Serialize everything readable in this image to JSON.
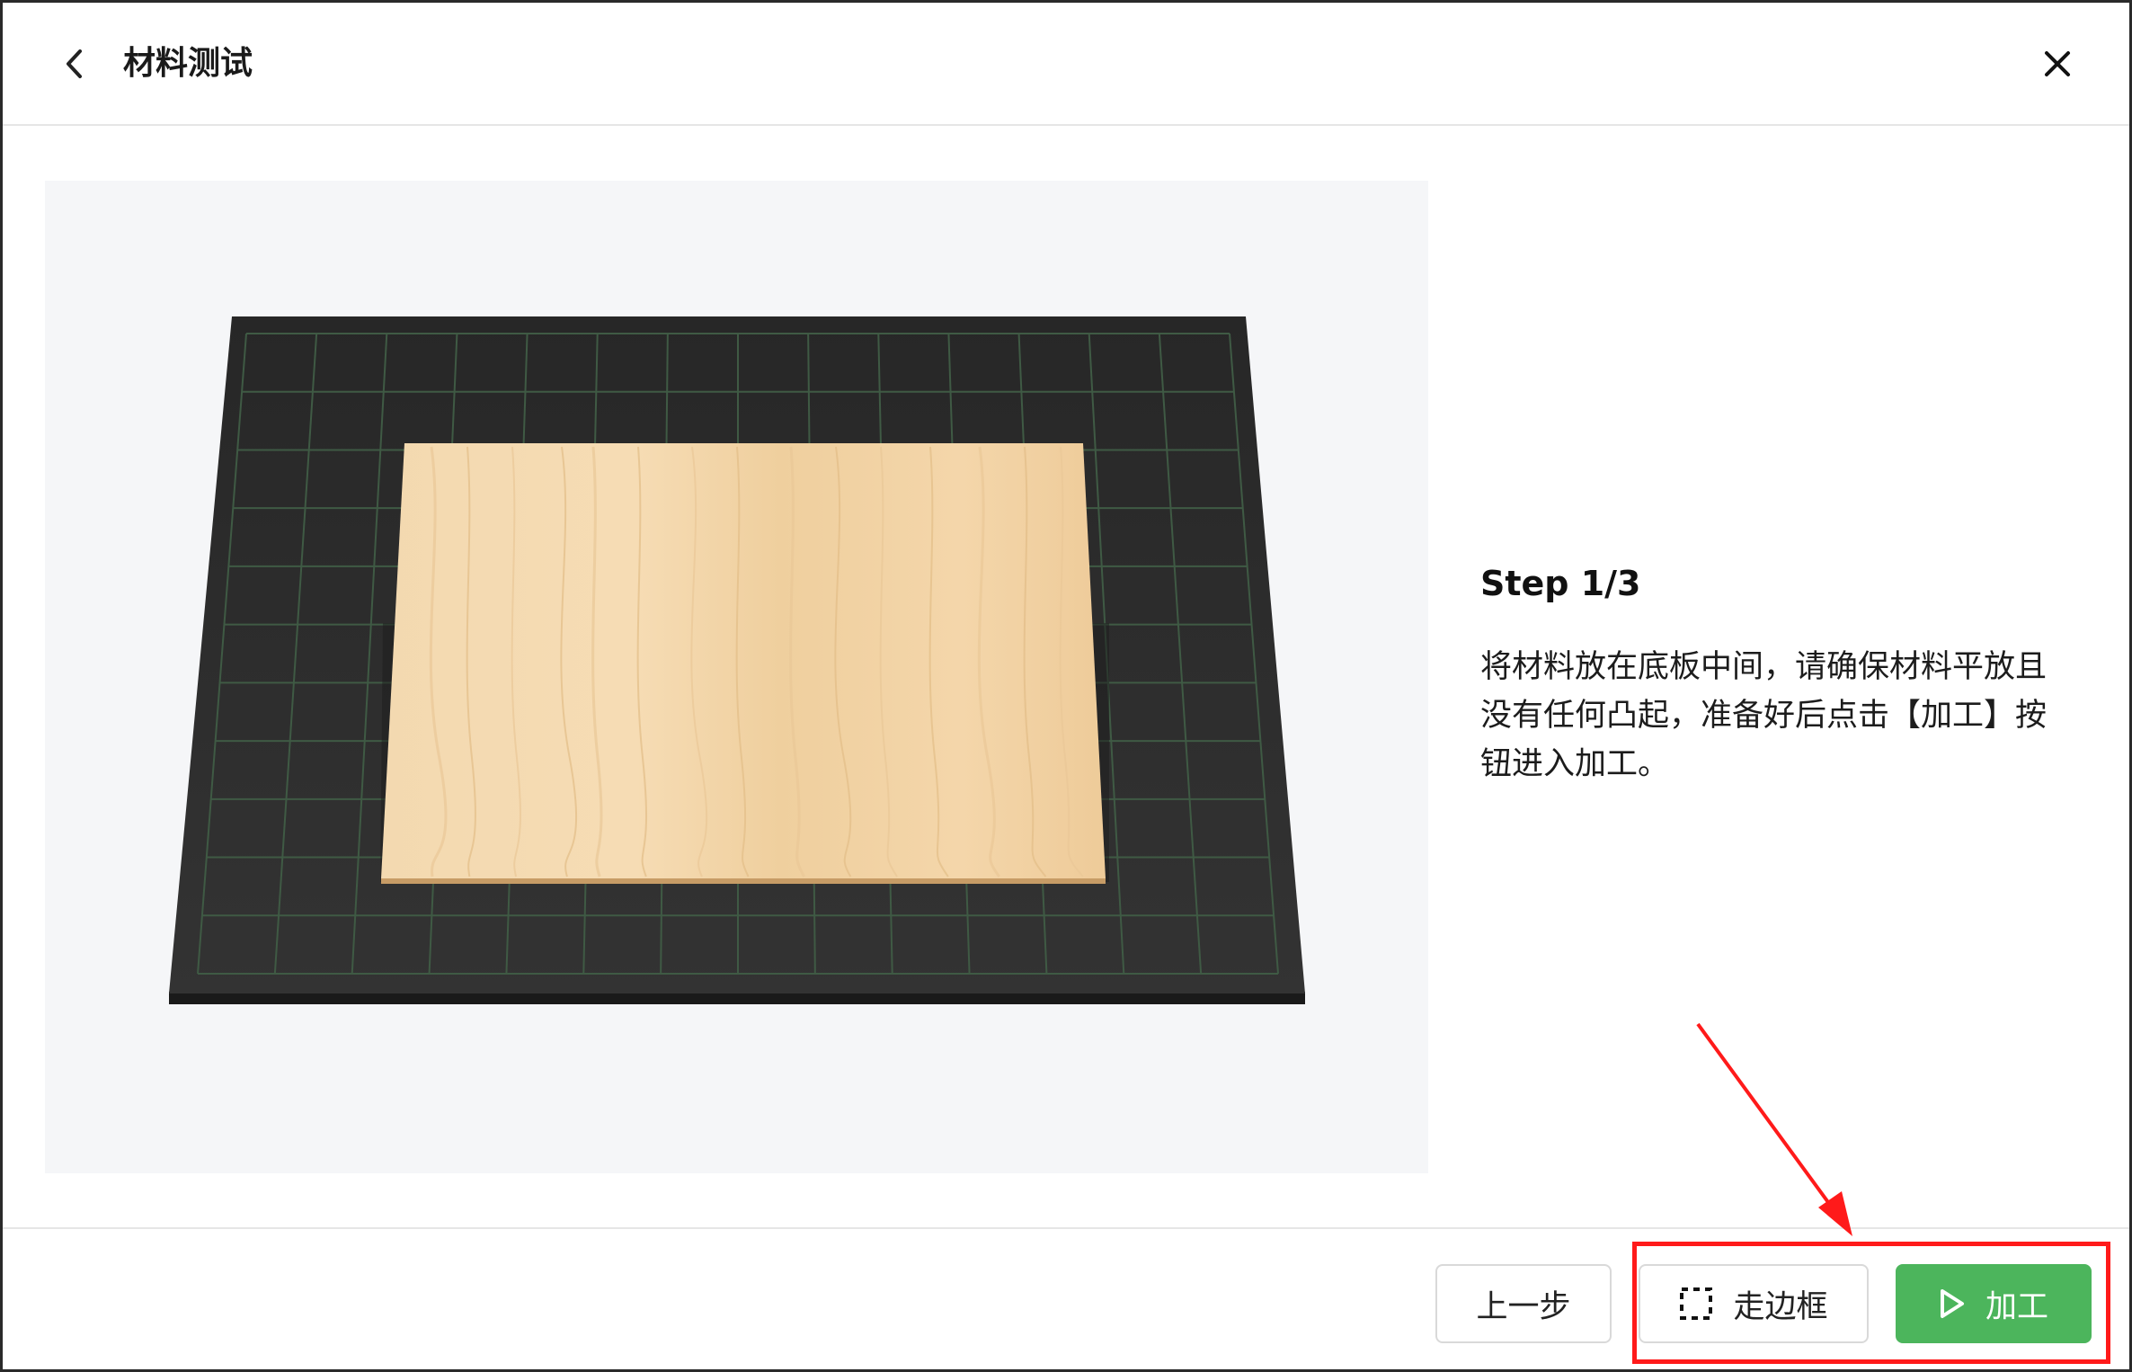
{
  "header": {
    "title": "材料测试",
    "back_icon": "chevron-left-icon",
    "close_icon": "close-icon"
  },
  "illustration": {
    "description_icon": "material-on-grid-board",
    "colors": {
      "background": "#f5f6f8",
      "board": "#2b2b2b",
      "grid": "#3f5a44",
      "wood": "#f0d3a6"
    }
  },
  "instruction": {
    "step": "Step 1/3",
    "text": "将材料放在底板中间，请确保材料平放且没有任何凸起，准备好后点击【加工】按钮进入加工。"
  },
  "footer": {
    "prev_label": "上一步",
    "frame_label": "走边框",
    "frame_icon": "dashed-frame-icon",
    "run_label": "加工",
    "run_icon": "play-icon"
  },
  "colors": {
    "accent": "#4cb55c",
    "annotation": "#ff1a1a"
  }
}
